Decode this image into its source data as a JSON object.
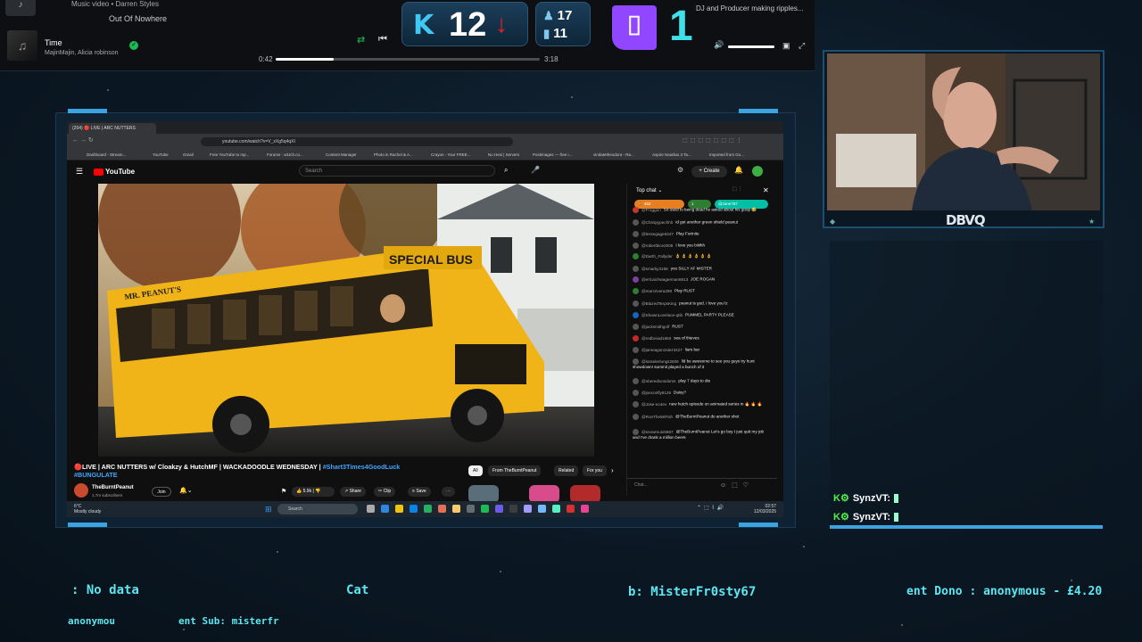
{
  "spotify": {
    "prev_track_sub": "Music video • Darren Styles",
    "prev_track": "Out Of Nowhere",
    "title": "Time",
    "artist": "MajinMajin, Alicia robinson",
    "time_elapsed": "0:42",
    "time_total": "3:18",
    "progress": 0.22,
    "right_text": "DJ and Producer making ripples..."
  },
  "kick": {
    "viewers": "12"
  },
  "stats": {
    "followers": "17",
    "subs": "11"
  },
  "twitch": {
    "viewers": "1",
    "logo": "twitch-icon"
  },
  "browser": {
    "tab_label": "(204) 🔴 LIVE | ARC NUTTERS",
    "url": "youtube.com/watch?v=V_xXg5q4qXI",
    "bookmarks": [
      "Dashboard - Stream...",
      "YouTube",
      "Gmail",
      "Free YouTube to mp...",
      "Forums - w1tch.co...",
      "Content Manager",
      "Photo in Rachel & A...",
      "Crayon - Your FREE...",
      "No Hesi | Servers",
      "Postimages — free i...",
      "vindatetheodora - Ra...",
      "Aspire Nautilus 3 Ta...",
      "Imported from Go..."
    ]
  },
  "youtube": {
    "logo": "YouTube",
    "search_placeholder": "Search",
    "create_label": "Create",
    "video_sign": "SPECIAL BUS",
    "video_bus_side": "MR. PEANUT'S",
    "title_prefix": "🔴LIVE | ARC NUTTERS w/ Cloakzy & HutchMF | WACKADOODLE WEDNESDAY | ",
    "title_tag1": "#Shart3Times4GoodLuck",
    "title_tag2": "#BUNGULATE",
    "channel": "TheBurntPeanut",
    "subscribers": "1.7m subscribers",
    "join": "Join",
    "likes": "5.9k",
    "share": "Share",
    "clip": "Clip",
    "save": "Save",
    "chips": [
      "All",
      "From TheBurntPeanut",
      "Related",
      "For you"
    ]
  },
  "chat": {
    "header": "Top chat",
    "pills": [
      "🏃 452",
      "1",
      "@zane767"
    ],
    "messages": [
      {
        "user": "@Fr1gg1n",
        "text": "So used to being dead he asked about his goop 😂",
        "color": "#c0392b"
      },
      {
        "user": "@Chrispypechhh",
        "text": "id get another green shield peanut",
        "color": "#555"
      },
      {
        "user": "@lessegage6347",
        "text": "Play Fortnite",
        "color": "#555"
      },
      {
        "user": "@robertbice2006",
        "text": "I love you biiiihh",
        "color": "#555"
      },
      {
        "user": "@Darth_Fallyder",
        "text": "👌 👌 👌 👌 👌 👌",
        "color": "#2e7d32"
      },
      {
        "user": "@smarky3168",
        "text": "you SILLY AF MISTER",
        "color": "#555"
      },
      {
        "user": "@erlcaichwagerman6913",
        "text": "JOE ROGAN",
        "color": "#7b3fa0"
      },
      {
        "user": "@marcrivera298",
        "text": "Play RUST",
        "color": "#2e7d32"
      },
      {
        "user": "@BlazedTerpsKing",
        "text": "peanut is god. I love you lz",
        "color": "#555"
      },
      {
        "user": "@ShawnLovelace-qtib",
        "text": "PUMMEL PARTY PLEASE",
        "color": "#1565c0"
      },
      {
        "user": "@jacksmithgolf",
        "text": "RUST",
        "color": "#555"
      },
      {
        "user": "@redbread1660",
        "text": "sea of thieves",
        "color": "#c62828"
      },
      {
        "user": "@jameagonzalez3427",
        "text": "liars bar",
        "color": "#555"
      },
      {
        "user": "@losselerlungs2606",
        "text": "lld be awesome to see you guys try hunt showdown! summit played a bunch of it",
        "color": "#555"
      },
      {
        "user": "@oberedivosdoms",
        "text": "play 7 days to die",
        "color": "#555"
      },
      {
        "user": "@joeconfly8126",
        "text": "Daisy?",
        "color": "#555"
      },
      {
        "user": "@Jose-ec4ev",
        "text": "new hutch episode on animated series in 🔥 🔥 🔥",
        "color": "#555"
      },
      {
        "user": "@RonTheWiFish",
        "text": "@TheBurntPeanut do another shot",
        "color": "#555"
      },
      {
        "user": "@snowmulo5967",
        "text": "@TheBurntPeanut Let's go boy I just quit my job and I've drank a million beers",
        "color": "#555"
      }
    ],
    "input_placeholder": "Chat..."
  },
  "taskbar": {
    "temp": "6°C",
    "weather": "Mostly cloudy",
    "search": "Search",
    "time": "02:57",
    "date": "12/03/2025"
  },
  "webcam": {
    "logo": "DBVQ"
  },
  "stream_chat": [
    {
      "user": "SynzVT",
      "sep": ":"
    },
    {
      "user": "SynzVT",
      "sep": ":"
    }
  ],
  "ticker": {
    "item1": ": No data",
    "item2": "Cat",
    "item3": "b: MisterFr0sty67",
    "item4": "ent Dono : anonymous - £4.20",
    "item5": "anonymou",
    "item6": "ent Sub: misterfr"
  }
}
